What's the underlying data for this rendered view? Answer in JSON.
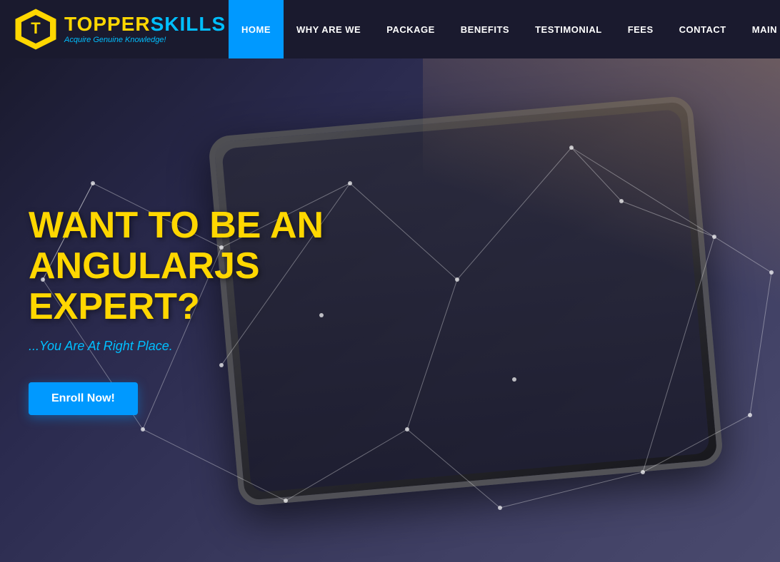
{
  "brand": {
    "name_part1": "TOPPER",
    "name_part2": "SKILLS",
    "tagline": "Acquire Genuine Knowledge!"
  },
  "navbar": {
    "items": [
      {
        "label": "HOME",
        "active": true
      },
      {
        "label": "WHY ARE WE",
        "active": false
      },
      {
        "label": "PACKAGE",
        "active": false
      },
      {
        "label": "BENEFITS",
        "active": false
      },
      {
        "label": "TESTIMONIAL",
        "active": false
      },
      {
        "label": "FEES",
        "active": false
      },
      {
        "label": "CONTACT",
        "active": false
      },
      {
        "label": "MAIN",
        "active": false
      }
    ]
  },
  "hero": {
    "title_line1": "WANT TO BE AN ANGULARJS",
    "title_line2": "EXPERT?",
    "subtitle": "...You Are At Right Place.",
    "cta_label": "Enroll Now!"
  }
}
